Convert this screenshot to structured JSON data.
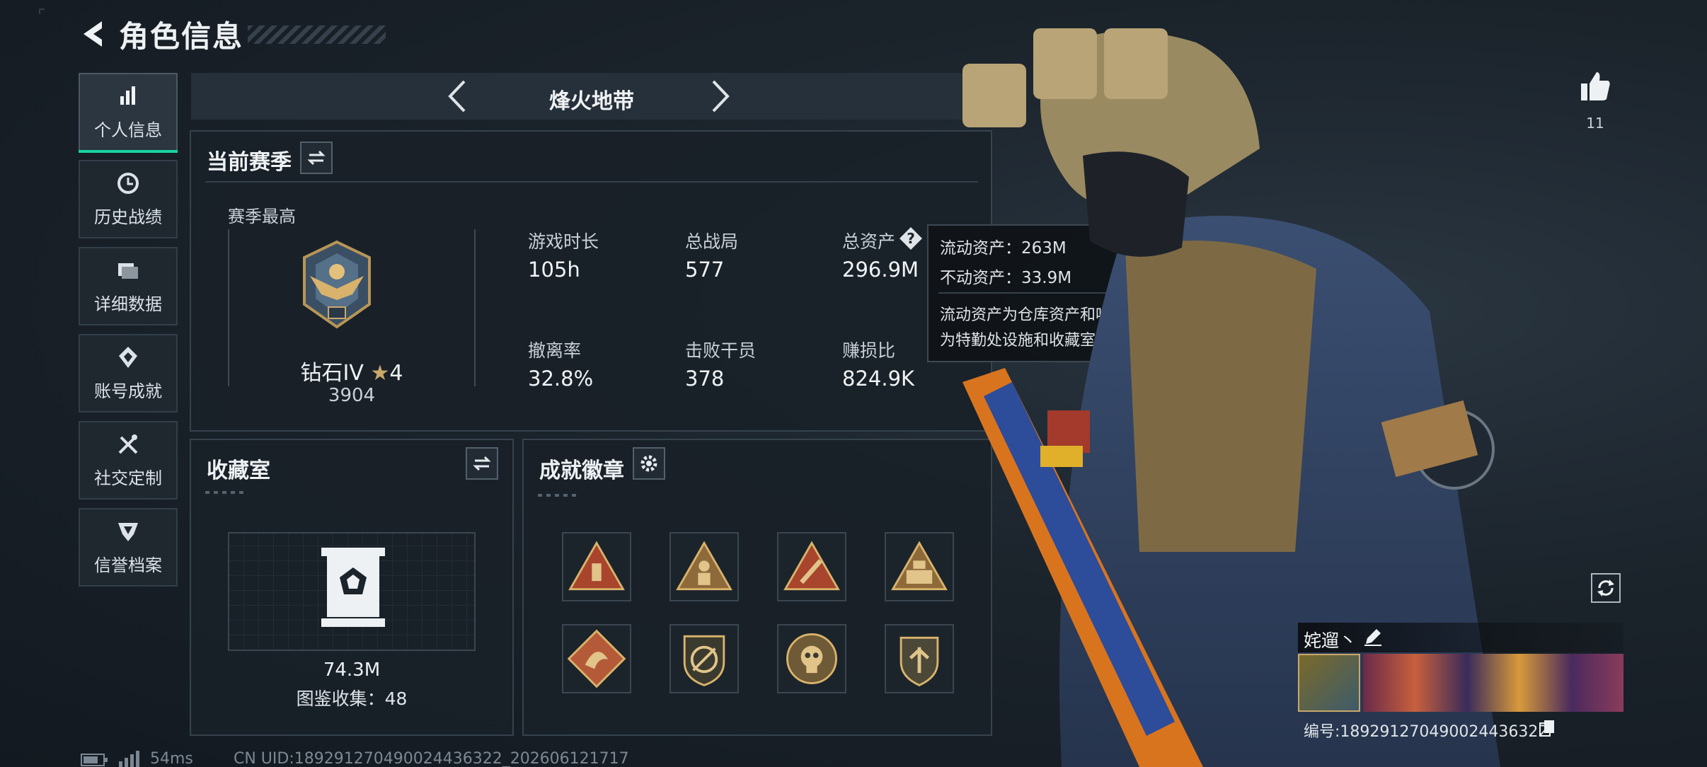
{
  "header": {
    "title": "角色信息"
  },
  "sidebar": {
    "items": [
      {
        "label": "个人信息",
        "icon": "bar-chart-icon",
        "active": true
      },
      {
        "label": "历史战绩",
        "icon": "history-icon",
        "active": false
      },
      {
        "label": "详细数据",
        "icon": "folder-icon",
        "active": false
      },
      {
        "label": "账号成就",
        "icon": "achievement-icon",
        "active": false
      },
      {
        "label": "社交定制",
        "icon": "tools-icon",
        "active": false
      },
      {
        "label": "信誉档案",
        "icon": "reputation-icon",
        "active": false
      }
    ]
  },
  "mode_tab": {
    "label": "烽火地带"
  },
  "season": {
    "title": "当前赛季",
    "best_label": "赛季最高",
    "rank_name": "钻石IV",
    "rank_stars": "4",
    "rank_score": "3904",
    "stats": [
      {
        "label": "游戏时长",
        "value": "105h"
      },
      {
        "label": "总战局",
        "value": "577"
      },
      {
        "label": "总资产",
        "value": "296.9M"
      },
      {
        "label": "撤离率",
        "value": "32.8%"
      },
      {
        "label": "击败干员",
        "value": "378"
      },
      {
        "label": "赚损比",
        "value": "824.9K"
      }
    ]
  },
  "tooltip": {
    "line1": "流动资产：263M",
    "line2": "不动资产：33.9M",
    "desc1": "流动资产为仓库资产和哈夫币，不动资产",
    "desc2": "为特勤处设施和收藏室设施"
  },
  "collection": {
    "title": "收藏室",
    "value": "74.3M",
    "count": "图鉴收集：48"
  },
  "badges": {
    "title": "成就徽章",
    "icons": [
      "ammo-badge-icon",
      "soldier-badge-icon",
      "strike-badge-icon",
      "team-badge-icon",
      "dragon-badge-icon",
      "rifle-badge-icon",
      "skull-badge-icon",
      "shield-badge-icon"
    ]
  },
  "likes": {
    "count": "11"
  },
  "player": {
    "name": "姹遛丶",
    "id": "编号:18929127049002443632​2"
  },
  "footer": {
    "ping": "54ms",
    "uid": "CN UID:189291270490024436322_202606121717"
  },
  "colors": {
    "accent": "#18d2a3",
    "gold": "#c9a86a",
    "badge_red": "#a8452c"
  }
}
